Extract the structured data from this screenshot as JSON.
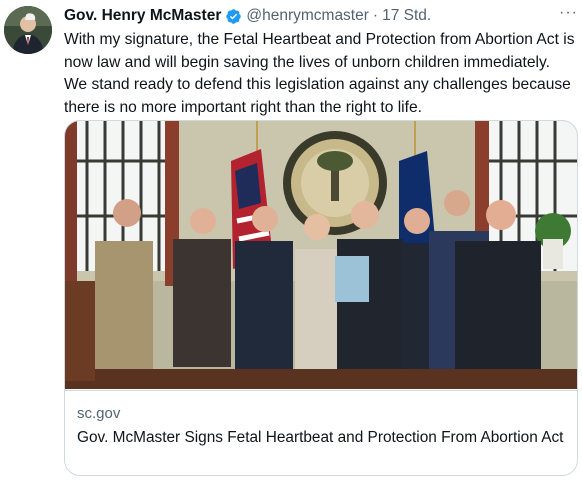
{
  "author": {
    "name": "Gov. Henry McMaster",
    "handle": "@henrymcmaster",
    "time": "17 Std."
  },
  "tweet": {
    "text": "With my signature, the Fetal Heartbeat and Protection from Abortion Act is now law and will begin saving the lives of unborn children immediately. We stand ready to defend this legislation against any challenges because there is no more important right than the right to life."
  },
  "card": {
    "domain": "sc.gov",
    "title": "Gov. McMaster Signs Fetal Heartbeat and Protection From Abortion Act"
  },
  "icons": {
    "verified": "verified-badge-icon",
    "more": "more-options-icon"
  },
  "colors": {
    "accent": "#1d9bf0",
    "secondary_text": "#536471",
    "border": "#cfd9de"
  },
  "more_glyph": "···",
  "separator": "·"
}
